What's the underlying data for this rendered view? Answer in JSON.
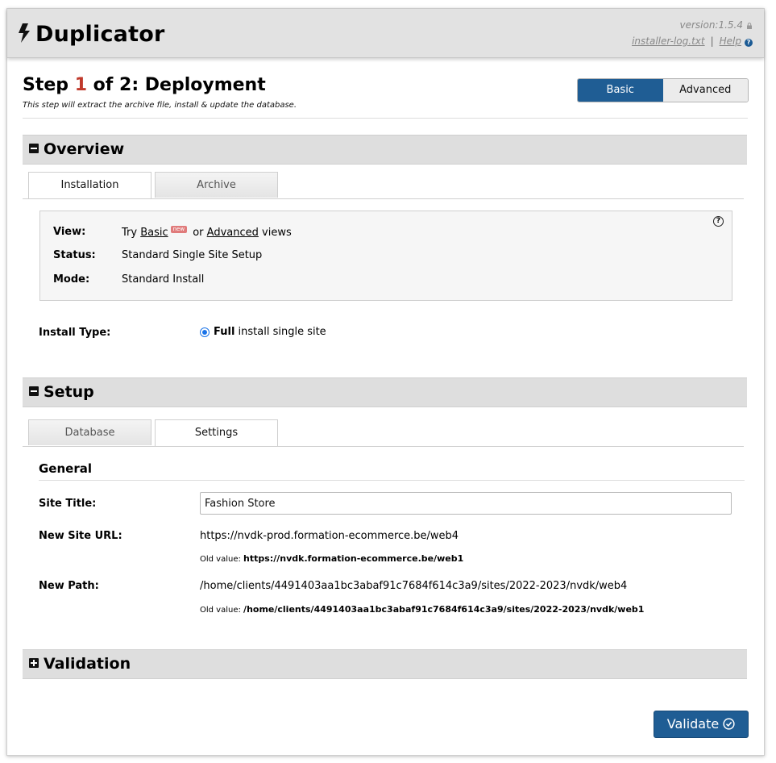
{
  "header": {
    "app_title": "Duplicator",
    "version": "version:1.5.4",
    "log_link": "installer-log.txt",
    "separator": "|",
    "help_link": "Help",
    "help_icon_text": "?"
  },
  "step": {
    "prefix": "Step ",
    "number": "1",
    "suffix": " of 2: Deployment",
    "description": "This step will extract the archive file, install & update the database."
  },
  "view_toggle": {
    "basic": "Basic",
    "advanced": "Advanced",
    "selected": "Basic"
  },
  "overview": {
    "title": "Overview",
    "tabs": [
      "Installation",
      "Archive"
    ],
    "active_tab": "Installation",
    "help_glyph": "?",
    "view_label": "View:",
    "view_try": "Try ",
    "view_basic": "Basic",
    "view_new_badge": "new",
    "view_or": " or ",
    "view_advanced": "Advanced",
    "view_views": " views",
    "status_label": "Status:",
    "status_value": "Standard Single Site Setup",
    "mode_label": "Mode:",
    "mode_value": "Standard Install",
    "install_type_label": "Install Type:",
    "install_type_bold": "Full",
    "install_type_rest": " install single site"
  },
  "setup": {
    "title": "Setup",
    "tabs": [
      "Database",
      "Settings"
    ],
    "active_tab": "Settings",
    "general_heading": "General",
    "site_title_label": "Site Title:",
    "site_title_value": "Fashion Store",
    "new_url_label": "New Site URL:",
    "new_url_value": "https://nvdk-prod.formation-ecommerce.be/web4",
    "old_value_prefix": "Old value: ",
    "old_url_value": "https://nvdk.formation-ecommerce.be/web1",
    "new_path_label": "New Path:",
    "new_path_value": "/home/clients/4491403aa1bc3abaf91c7684f614c3a9/sites/2022-2023/nvdk/web4",
    "old_path_value": "/home/clients/4491403aa1bc3abaf91c7684f614c3a9/sites/2022-2023/nvdk/web1"
  },
  "validation": {
    "title": "Validation"
  },
  "footer": {
    "validate_button": "Validate"
  },
  "colors": {
    "primary": "#1f5d94",
    "step_number": "#c0392b",
    "section_bg": "#dedede"
  }
}
